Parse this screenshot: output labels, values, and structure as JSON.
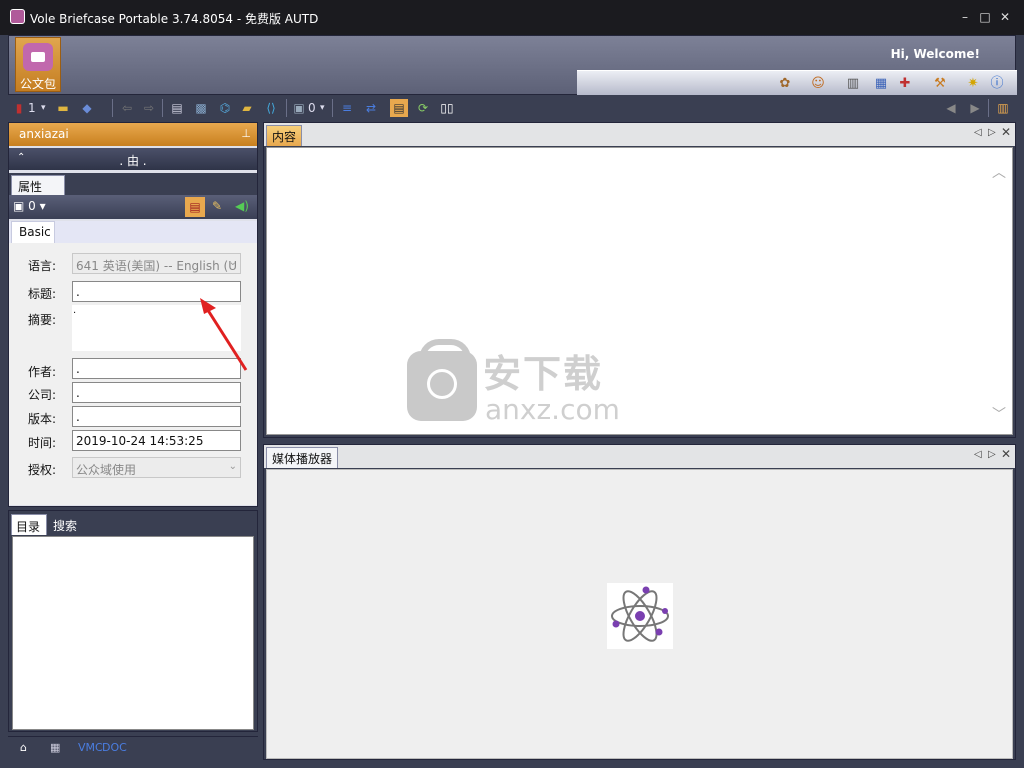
{
  "window": {
    "title": "Vole Briefcase Portable  3.74.8054 - 免费版 AUTD"
  },
  "ribbon": {
    "app_button_label": "公文包",
    "welcome": "Hi, Welcome!"
  },
  "toolbar": {
    "view_count": "1",
    "doc_count": "0"
  },
  "left_panel": {
    "header": "anxiazai",
    "nav_path": ". 由 .",
    "props_tab": "属性",
    "props_toolbar_count": "0",
    "basic_tab": "Basic",
    "fields": {
      "language_label": "语言:",
      "language_value": "641 英语(美国) -- English (U",
      "title_label": "标题:",
      "title_value": ".",
      "abstract_label": "摘要:",
      "abstract_value": ".",
      "author_label": "作者:",
      "author_value": ".",
      "company_label": "公司:",
      "company_value": ".",
      "version_label": "版本:",
      "version_value": ".",
      "time_label": "时间:",
      "time_value": "2019-10-24 14:53:25",
      "license_label": "授权:",
      "license_value": "公众域使用"
    }
  },
  "toc_panel": {
    "tab_toc": "目录",
    "tab_search": "搜索"
  },
  "statusbar": {
    "vmc": "VMC",
    "doc": "DOC"
  },
  "content_pane": {
    "tab": "内容",
    "watermark_big": "安下载",
    "watermark_small": "anxz.com"
  },
  "media_pane": {
    "tab": "媒体播放器"
  },
  "colors": {
    "accent_orange": "#e8a84e",
    "frame_dark": "#3a3f52",
    "annotation_red": "#e02020"
  }
}
